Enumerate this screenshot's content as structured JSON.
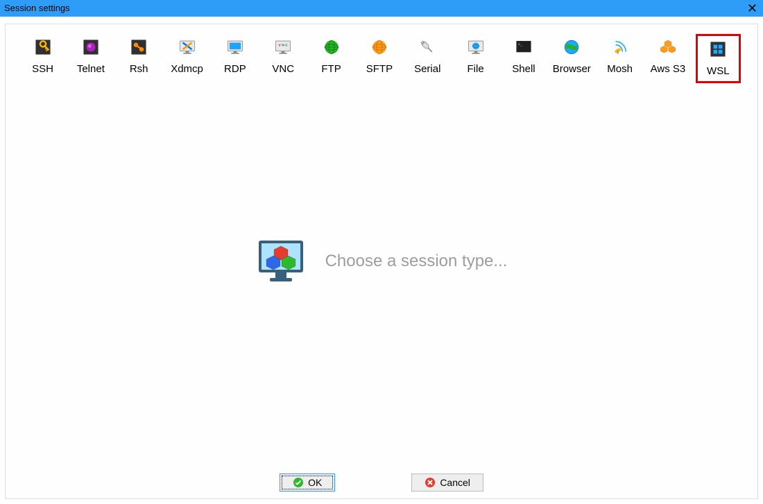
{
  "window": {
    "title": "Session settings"
  },
  "session_types": [
    {
      "id": "ssh",
      "label": "SSH"
    },
    {
      "id": "telnet",
      "label": "Telnet"
    },
    {
      "id": "rsh",
      "label": "Rsh"
    },
    {
      "id": "xdmcp",
      "label": "Xdmcp"
    },
    {
      "id": "rdp",
      "label": "RDP"
    },
    {
      "id": "vnc",
      "label": "VNC"
    },
    {
      "id": "ftp",
      "label": "FTP"
    },
    {
      "id": "sftp",
      "label": "SFTP"
    },
    {
      "id": "serial",
      "label": "Serial"
    },
    {
      "id": "file",
      "label": "File"
    },
    {
      "id": "shell",
      "label": "Shell"
    },
    {
      "id": "browser",
      "label": "Browser"
    },
    {
      "id": "mosh",
      "label": "Mosh"
    },
    {
      "id": "awss3",
      "label": "Aws S3"
    },
    {
      "id": "wsl",
      "label": "WSL",
      "highlighted": true
    }
  ],
  "center_message": "Choose a session type...",
  "buttons": {
    "ok": "OK",
    "cancel": "Cancel"
  }
}
